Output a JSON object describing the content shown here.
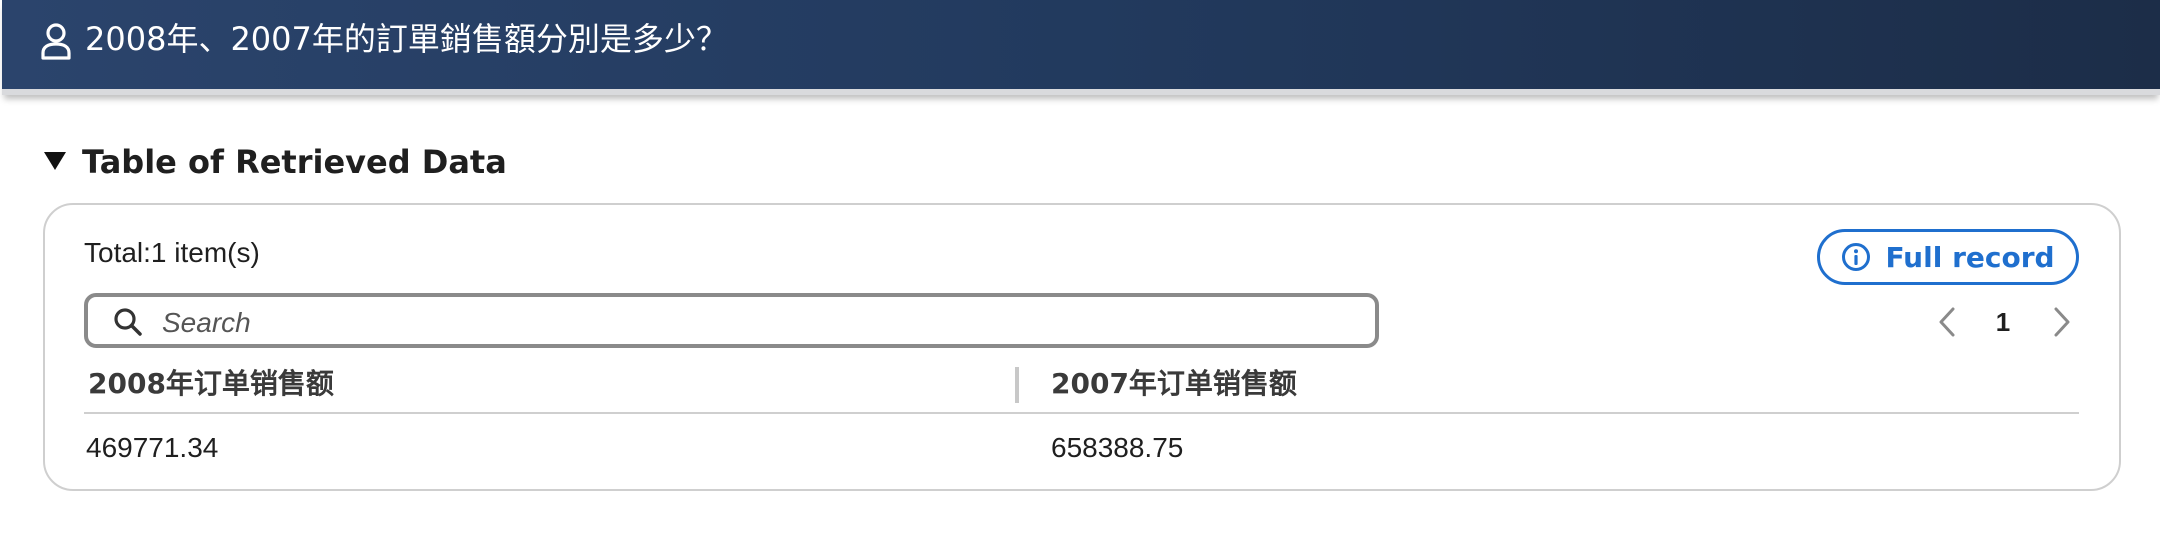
{
  "header": {
    "question": "2008年、2007年的訂單銷售額分別是多少？",
    "icon": "user-icon"
  },
  "section": {
    "title": "Table of Retrieved Data",
    "toggle_icon": "caret-down-icon"
  },
  "table_panel": {
    "total_label": "Total:1 item(s)",
    "full_record_label": "Full record",
    "full_record_icon": "info-icon",
    "search_placeholder": "Search",
    "search_value": "",
    "pagination": {
      "current_page": "1"
    },
    "columns": [
      "2008年订单销售额",
      "2007年订单销售额"
    ],
    "rows": [
      [
        "469771.34",
        "658388.75"
      ]
    ]
  },
  "colors": {
    "header_bg": "#223a5e",
    "accent": "#1f6fce",
    "border": "#cfcfcf"
  }
}
